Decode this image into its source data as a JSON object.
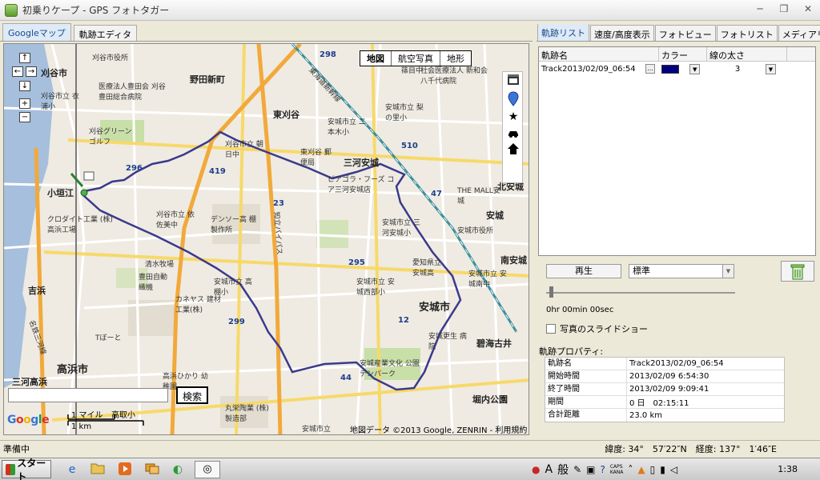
{
  "window": {
    "title": "初乗りケープ - GPS フォトタガー",
    "minimize": "─",
    "restore": "❐",
    "close": "✕"
  },
  "left_tabs": [
    {
      "label": "Googleマップ",
      "active": true
    },
    {
      "label": "軌跡エディタ",
      "active": false
    }
  ],
  "map": {
    "map_types": [
      "地図",
      "航空写真",
      "地形"
    ],
    "selected_map_type": "地図",
    "nav": {
      "up": "↑",
      "left": "←",
      "right": "→",
      "down": "↓",
      "zoom_in": "+",
      "zoom_out": "−"
    },
    "tools": {
      "marker": "marker-icon",
      "star": "star-icon",
      "car": "car-icon",
      "home": "home-icon",
      "film": "film-icon"
    },
    "search_value": "",
    "search_button": "検索",
    "scale_mile": "1 マイル",
    "scale_km": "1 km",
    "scale_place": "高取小",
    "google_logo": "Google",
    "attribution": "地図データ ©2013 Google, ZENRIN - 利用規約",
    "labels": {
      "kariyashi": "刈谷市",
      "kariya_shiyakusho": "刈谷市役所",
      "hospital": "医療法人豊田会 刈谷豊田総合病院",
      "kariya_shiritsu_koromo": "刈谷市立 衣浦小",
      "kariya_green": "刈谷グリーン ゴルフ",
      "odagaki": "小垣江",
      "kurodaito": "クロダイト工業 (株) 高浜工場",
      "yoshihama": "吉浜",
      "takahama": "高浜市",
      "mikawa_takahama": "三河高浜",
      "noda_shinmachi": "野田新町",
      "higashi_kariya": "東刈谷",
      "mikawa_anjo": "三河安城",
      "anjo_shi": "安城市",
      "anjo": "安城",
      "kita_anjo": "北安城",
      "minami_anjo": "南安城",
      "hekinan_furui": "碧海古井",
      "horiuchi_koen": "堀内公園",
      "denso": "デンソー高 棚製作所",
      "kanekasu": "カネヤス 建材工業(株)",
      "toyota_jidoshokki": "豊田自動 織機",
      "takahama_hikari": "高浜ひかり 幼稚園",
      "shimizu_bokujo": "清水牧場",
      "marujo": "丸栄陶業 (株) 製造部",
      "the_mall": "THE MALL安城",
      "anjo_shiyakusho": "安城市役所",
      "anjo_kosei": "安城更生 病院",
      "denpark": "安城産業文化 公園デンパーク",
      "kariya_asahi": "刈谷市立 朝日中",
      "kariya_izumi": "刈谷市立 依佐美中",
      "anjo_nishibu": "安城市立 安城西部小",
      "anjo_takaharu": "安城市立 高棚小",
      "higashi_kariya_post": "東刈谷 郵便局",
      "piago": "ピアゴラ・フーズ コア三河安城店",
      "tkasa": "Tぼーと",
      "jr_tokaido": "東海道新幹線",
      "chiryu_bypass": "知立バイパス",
      "meitetsu_mikawa": "名鉄三河線",
      "anjo_shiritsu_nihongi": "安城市立 二本木小",
      "anjo_shiritsu_nashi": "安城市立 梨の里小",
      "anjo_shiritsu_mikawaanjo": "安城市立 三河安城小",
      "aichi_anjo_koko": "愛知県立 安城高",
      "anjo_minami_chu": "安城市立 安城南中",
      "anjo_shiritsu_anjo": "安城市立",
      "shin_meiwa": "社会医療法人 新和会八千代病院",
      "shinohime": "篠目中",
      "route_296": "296",
      "route_419": "419",
      "route_23": "23",
      "route_299": "299",
      "route_47": "47",
      "route_295": "295",
      "route_12": "12",
      "route_44": "44",
      "route_510": "510",
      "route_298": "298"
    }
  },
  "right_tabs": [
    {
      "label": "軌跡リスト",
      "active": true
    },
    {
      "label": "速度/高度表示",
      "active": false
    },
    {
      "label": "フォトビュー",
      "active": false
    },
    {
      "label": "フォトリスト",
      "active": false
    },
    {
      "label": "メディアリ",
      "active": false
    }
  ],
  "right_tab_arrow": "▸",
  "track_table": {
    "headers": [
      "軌跡名",
      "カラー",
      "線の太さ"
    ],
    "rows": [
      {
        "name": "Track2013/02/09_06:54",
        "dots": "...",
        "color": "#000080",
        "width": "3"
      }
    ]
  },
  "playback": {
    "play_label": "再生",
    "speed_value": "標準",
    "time_text": "0hr 00min 00sec",
    "slideshow_label": "写真のスライドショー"
  },
  "properties": {
    "title": "軌跡プロパティ:",
    "rows": [
      {
        "key": "軌跡名",
        "value": "Track2013/02/09_06:54"
      },
      {
        "key": "開始時間",
        "value": "2013/02/09 6:54:30"
      },
      {
        "key": "終了時間",
        "value": "2013/02/09 9:09:41"
      },
      {
        "key": "期間",
        "value": "0 日　02:15:11"
      },
      {
        "key": "合計距離",
        "value": "23.0 km"
      }
    ]
  },
  "status": {
    "text": "準備中",
    "coords": "緯度: 34°　57′22″N　経度: 137°　1′46″E"
  },
  "taskbar": {
    "start_label": "スタート",
    "clock": "1:38",
    "ime_a": "A",
    "ime_kan": "般",
    "caps": "CAPS",
    "kana": "KANA"
  },
  "colors": {
    "track": "#3a3a8c",
    "highway": "#f2a93b",
    "road": "#ffffff",
    "major_road": "#f7d96b",
    "water": "#a5bfdd",
    "park": "#c8dfa8",
    "map_bg": "#efebe2"
  }
}
